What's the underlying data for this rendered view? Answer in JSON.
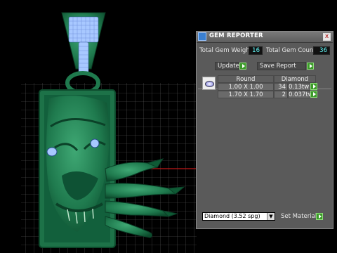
{
  "viewport": {
    "model": "pendant-with-monster-face",
    "colors": {
      "background": "#000000",
      "grid": "#6a6a6a",
      "model": "#1e6f4a",
      "gems": "#8fb4ff",
      "axis": "#c01818"
    }
  },
  "panel": {
    "title": "GEM REPORTER",
    "close_label": "x",
    "total_weight_label": "Total Gem Weight",
    "total_weight_value": "16",
    "total_count_label": "Total Gem Count",
    "total_count_value": "36",
    "update_label": "Update",
    "save_report_label": "Save Report",
    "table": {
      "headers": [
        "Round",
        "Diamond"
      ],
      "rows": [
        {
          "size": "1.00 X 1.00",
          "count": "34",
          "weight": "0.13tw"
        },
        {
          "size": "1.70 X 1.70",
          "count": "2",
          "weight": "0.037tw"
        }
      ]
    },
    "material_select_value": "Diamond    (3.52 spg)",
    "set_material_label": "Set Material"
  }
}
